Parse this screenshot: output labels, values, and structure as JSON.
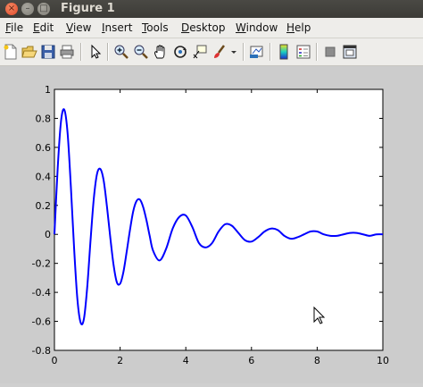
{
  "window": {
    "title": "Figure 1",
    "close_glyph": "×",
    "min_glyph": "–",
    "max_glyph": "□"
  },
  "menu": [
    {
      "label": "File",
      "mnemonic": "F",
      "rest": "ile"
    },
    {
      "label": "Edit",
      "mnemonic": "E",
      "rest": "dit"
    },
    {
      "label": "View",
      "mnemonic": "V",
      "rest": "iew"
    },
    {
      "label": "Insert",
      "mnemonic": "I",
      "rest": "nsert"
    },
    {
      "label": "Tools",
      "mnemonic": "T",
      "rest": "ools"
    },
    {
      "label": "Desktop",
      "mnemonic": "D",
      "rest": "esktop"
    },
    {
      "label": "Window",
      "mnemonic": "W",
      "rest": "indow"
    },
    {
      "label": "Help",
      "mnemonic": "H",
      "rest": "elp"
    }
  ],
  "toolbar": {
    "buttons": [
      "new-figure-icon",
      "open-file-icon",
      "save-icon",
      "print-icon",
      "pointer-icon",
      "zoom-in-icon",
      "zoom-out-icon",
      "pan-icon",
      "rotate-3d-icon",
      "data-cursor-icon",
      "brush-icon",
      "dropdown-arrow-icon",
      "link-plot-icon",
      "colorbar-icon",
      "legend-icon",
      "hide-plot-tools-icon",
      "show-plot-tools-icon"
    ]
  },
  "chart_data": {
    "type": "line",
    "title": "",
    "xlabel": "",
    "ylabel": "",
    "xlim": [
      0,
      10
    ],
    "ylim": [
      -0.8,
      1
    ],
    "xticks": [
      "0",
      "2",
      "4",
      "6",
      "8",
      "10"
    ],
    "yticks": [
      "-0.8",
      "-0.6",
      "-0.4",
      "-0.2",
      "0",
      "0.2",
      "0.4",
      "0.6",
      "0.8",
      "1"
    ],
    "grid": false,
    "line_color": "#0000ff",
    "series": [
      {
        "x": [
          0,
          0.1,
          0.2,
          0.3,
          0.4,
          0.5,
          0.6,
          0.7,
          0.8,
          0.9,
          1.0,
          1.1,
          1.2,
          1.3,
          1.4,
          1.5,
          1.6,
          1.7,
          1.8,
          1.9,
          2.0,
          2.1,
          2.2,
          2.3,
          2.4,
          2.5,
          2.6,
          2.7,
          2.8,
          2.9,
          3.0,
          3.2,
          3.4,
          3.6,
          3.8,
          4.0,
          4.2,
          4.4,
          4.6,
          4.8,
          5.0,
          5.2,
          5.4,
          5.6,
          5.8,
          6.0,
          6.2,
          6.4,
          6.6,
          6.8,
          7.0,
          7.2,
          7.4,
          7.6,
          7.8,
          8.0,
          8.2,
          8.4,
          8.6,
          8.8,
          9.0,
          9.2,
          9.4,
          9.6,
          9.8,
          10.0
        ],
        "y": [
          0.0,
          0.46,
          0.78,
          0.86,
          0.7,
          0.33,
          -0.1,
          -0.45,
          -0.61,
          -0.58,
          -0.36,
          -0.04,
          0.25,
          0.42,
          0.45,
          0.37,
          0.19,
          -0.02,
          -0.21,
          -0.33,
          -0.34,
          -0.26,
          -0.12,
          0.03,
          0.16,
          0.23,
          0.24,
          0.19,
          0.1,
          -0.01,
          -0.11,
          -0.18,
          -0.1,
          0.04,
          0.12,
          0.13,
          0.05,
          -0.06,
          -0.09,
          -0.06,
          0.02,
          0.07,
          0.06,
          0.01,
          -0.04,
          -0.05,
          -0.02,
          0.02,
          0.04,
          0.03,
          -0.01,
          -0.03,
          -0.02,
          0.0,
          0.02,
          0.02,
          0.0,
          -0.01,
          -0.01,
          0.0,
          0.01,
          0.01,
          0.0,
          -0.01,
          0.0,
          0.0
        ]
      }
    ]
  }
}
